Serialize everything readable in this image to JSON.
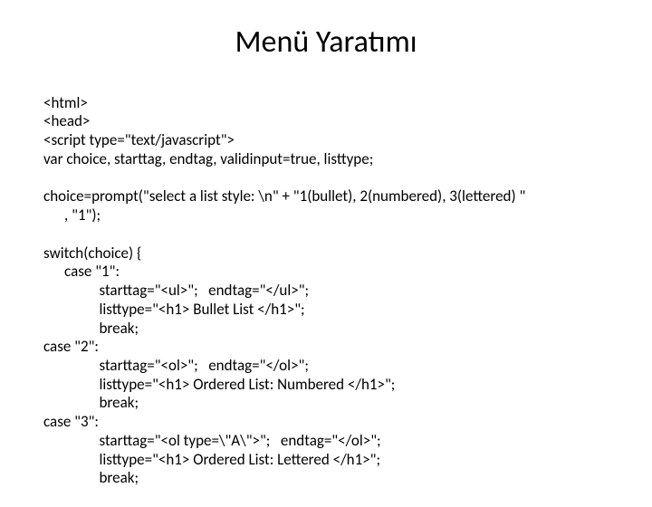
{
  "title": "Menü Yaratımı",
  "lines": {
    "l01": "<html>",
    "l02": "<head>",
    "l03": "<script type=\"text/javascript\">",
    "l04": "var choice, starttag, endtag, validinput=true, listtype;",
    "l05": "",
    "l06": "choice=prompt(\"select a list style: \\n\" + \"1(bullet), 2(numbered), 3(lettered) \"",
    "l07": "      , \"1\");",
    "l08": "",
    "l09": "switch(choice) {",
    "l10": "      case \"1\":",
    "l11": "                starttag=\"<ul>\";   endtag=\"</ul>\";",
    "l12": "                listtype=\"<h1> Bullet List </h1>\";",
    "l13": "                break;",
    "l14": "case \"2\":",
    "l15": "                starttag=\"<ol>\";   endtag=\"</ol>\";",
    "l16": "                listtype=\"<h1> Ordered List: Numbered </h1>\";",
    "l17": "                break;",
    "l18": "case \"3\":",
    "l19": "                starttag=\"<ol type=\\\"A\\\">\";   endtag=\"</ol>\";",
    "l20": "                listtype=\"<h1> Ordered List: Lettered </h1>\";",
    "l21": "                break;"
  }
}
